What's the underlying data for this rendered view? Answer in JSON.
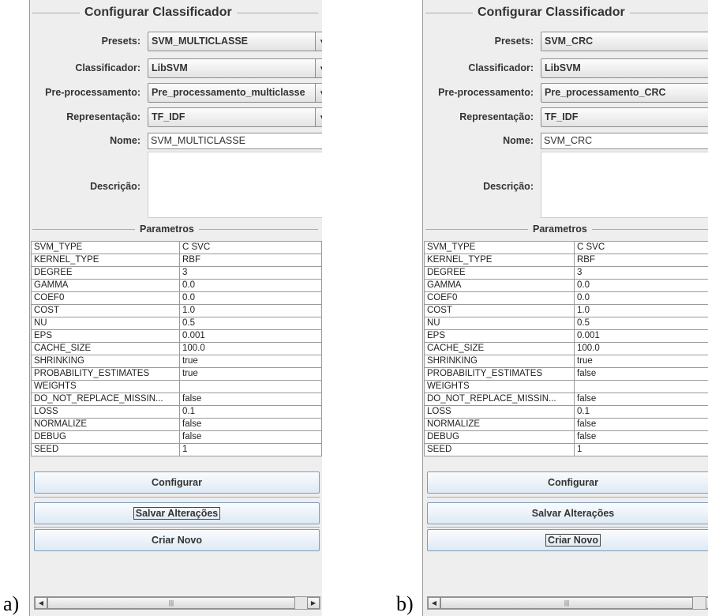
{
  "figure_labels": [
    "a)",
    "b)"
  ],
  "panels": [
    {
      "title": "Configurar Classificador",
      "form": {
        "presets_label": "Presets:",
        "presets_value": "SVM_MULTICLASSE",
        "classificador_label": "Classificador:",
        "classificador_value": "LibSVM",
        "preprocessamento_label": "Pre-processamento:",
        "preprocessamento_value": "Pre_processamento_multiclasse",
        "representacao_label": "Representação:",
        "representacao_value": "TF_IDF",
        "nome_label": "Nome:",
        "nome_value": "SVM_MULTICLASSE",
        "descricao_label": "Descrição:"
      },
      "params_title": "Parametros",
      "params": [
        [
          "SVM_TYPE",
          "C SVC"
        ],
        [
          "KERNEL_TYPE",
          "RBF"
        ],
        [
          "DEGREE",
          "3"
        ],
        [
          "GAMMA",
          "0.0"
        ],
        [
          "COEF0",
          "0.0"
        ],
        [
          "COST",
          "1.0"
        ],
        [
          "NU",
          "0.5"
        ],
        [
          "EPS",
          "0.001"
        ],
        [
          "CACHE_SIZE",
          "100.0"
        ],
        [
          "SHRINKING",
          "true"
        ],
        [
          "PROBABILITY_ESTIMATES",
          "true"
        ],
        [
          "WEIGHTS",
          ""
        ],
        [
          "DO_NOT_REPLACE_MISSIN...",
          "false"
        ],
        [
          "LOSS",
          "0.1"
        ],
        [
          "NORMALIZE",
          "false"
        ],
        [
          "DEBUG",
          "false"
        ],
        [
          "SEED",
          "1"
        ]
      ],
      "buttons": {
        "configurar": "Configurar",
        "salvar": "Salvar Alterações",
        "criar": "Criar Novo"
      },
      "scrollbar": {
        "left_arrow": "◀",
        "right_arrow": "▶",
        "grip": "|||"
      }
    },
    {
      "title": "Configurar Classificador",
      "form": {
        "presets_label": "Presets:",
        "presets_value": "SVM_CRC",
        "classificador_label": "Classificador:",
        "classificador_value": "LibSVM",
        "preprocessamento_label": "Pre-processamento:",
        "preprocessamento_value": "Pre_processamento_CRC",
        "representacao_label": "Representação:",
        "representacao_value": "TF_IDF",
        "nome_label": "Nome:",
        "nome_value": "SVM_CRC",
        "descricao_label": "Descrição:"
      },
      "params_title": "Parametros",
      "params": [
        [
          "SVM_TYPE",
          "C SVC"
        ],
        [
          "KERNEL_TYPE",
          "RBF"
        ],
        [
          "DEGREE",
          "3"
        ],
        [
          "GAMMA",
          "0.0"
        ],
        [
          "COEF0",
          "0.0"
        ],
        [
          "COST",
          "1.0"
        ],
        [
          "NU",
          "0.5"
        ],
        [
          "EPS",
          "0.001"
        ],
        [
          "CACHE_SIZE",
          "100.0"
        ],
        [
          "SHRINKING",
          "true"
        ],
        [
          "PROBABILITY_ESTIMATES",
          "false"
        ],
        [
          "WEIGHTS",
          ""
        ],
        [
          "DO_NOT_REPLACE_MISSIN...",
          "false"
        ],
        [
          "LOSS",
          "0.1"
        ],
        [
          "NORMALIZE",
          "false"
        ],
        [
          "DEBUG",
          "false"
        ],
        [
          "SEED",
          "1"
        ]
      ],
      "buttons": {
        "configurar": "Configurar",
        "salvar": "Salvar Alterações",
        "criar": "Criar Novo"
      },
      "scrollbar": {
        "left_arrow": "◀",
        "right_arrow": "▶",
        "grip": "|||"
      }
    }
  ]
}
